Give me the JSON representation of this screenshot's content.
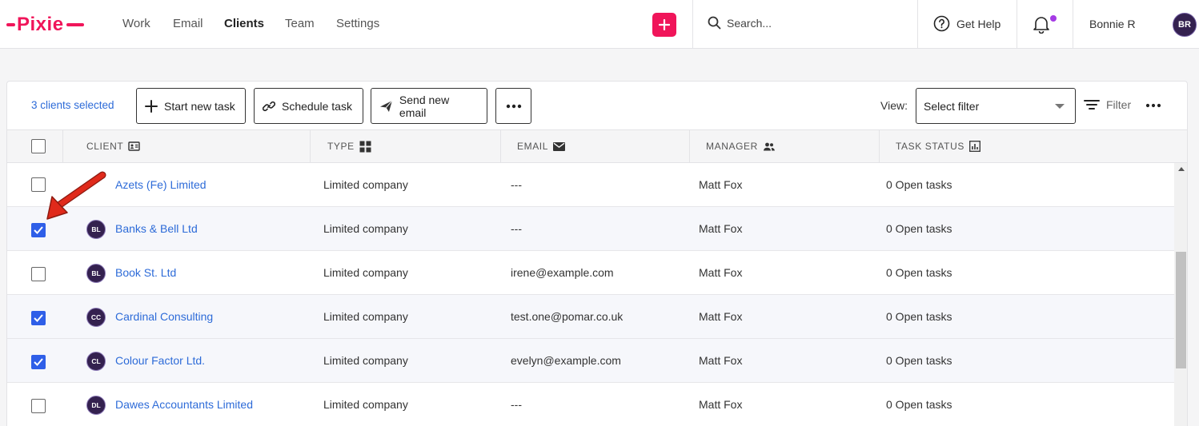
{
  "brand": {
    "name": "Pixie",
    "color": "#f0155a"
  },
  "nav": [
    {
      "label": "Work",
      "active": false
    },
    {
      "label": "Email",
      "active": false
    },
    {
      "label": "Clients",
      "active": true
    },
    {
      "label": "Team",
      "active": false
    },
    {
      "label": "Settings",
      "active": false
    }
  ],
  "header": {
    "search_placeholder": "Search...",
    "help_label": "Get Help",
    "user_name": "Bonnie R",
    "user_initials": "BR"
  },
  "toolbar": {
    "selected_count": "3 clients selected",
    "start_task": "Start new task",
    "schedule_task": "Schedule task",
    "send_email": "Send new email",
    "view_label": "View:",
    "view_select": "Select filter",
    "filter_label": "Filter"
  },
  "table": {
    "columns": [
      "CLIENT",
      "TYPE",
      "EMAIL",
      "MANAGER",
      "TASK STATUS"
    ],
    "rows": [
      {
        "initials": "",
        "name": "Azets (Fe) Limited",
        "type": "Limited company",
        "email": "---",
        "manager": "Matt Fox",
        "status": "0 Open tasks",
        "checked": false
      },
      {
        "initials": "BL",
        "name": "Banks & Bell Ltd",
        "type": "Limited company",
        "email": "---",
        "manager": "Matt Fox",
        "status": "0 Open tasks",
        "checked": true
      },
      {
        "initials": "BL",
        "name": "Book St. Ltd",
        "type": "Limited company",
        "email": "irene@example.com",
        "manager": "Matt Fox",
        "status": "0 Open tasks",
        "checked": false
      },
      {
        "initials": "CC",
        "name": "Cardinal Consulting",
        "type": "Limited company",
        "email": "test.one@pomar.co.uk",
        "manager": "Matt Fox",
        "status": "0 Open tasks",
        "checked": true
      },
      {
        "initials": "CL",
        "name": "Colour Factor Ltd.",
        "type": "Limited company",
        "email": "evelyn@example.com",
        "manager": "Matt Fox",
        "status": "0 Open tasks",
        "checked": true
      },
      {
        "initials": "DL",
        "name": "Dawes Accountants Limited",
        "type": "Limited company",
        "email": "---",
        "manager": "Matt Fox",
        "status": "0 Open tasks",
        "checked": false
      }
    ]
  },
  "colors": {
    "accent": "#f0155a",
    "link": "#2d6bd8",
    "checkbox": "#2f5fe8",
    "avatar": "#34214f",
    "annotation_arrow": "#e02a1b"
  }
}
